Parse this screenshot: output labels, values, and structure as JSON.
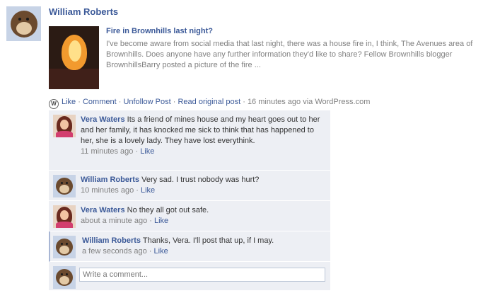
{
  "post": {
    "author": "William Roberts",
    "title": "Fire in Brownhills last night?",
    "excerpt": "I've become aware from social media that last night, there was a house fire in, I think, The Avenues area of Brownhills. Does anyone have any further information they'd like to share? Fellow Brownhills blogger BrownhillsBarry posted a picture of the fire ...",
    "actions": {
      "like": "Like",
      "comment": "Comment",
      "unfollow": "Unfollow Post",
      "read_original": "Read original post",
      "timestamp": "16 minutes ago via WordPress.com",
      "sep": " · "
    }
  },
  "comments": [
    {
      "author": "Vera Waters",
      "text": "Its a friend of mines house and my heart goes out to her and her family, it has knocked me sick to think that has happened to her, she is a lovely lady. They have lost everythink.",
      "time": "11 minutes ago",
      "like": "Like"
    },
    {
      "author": "William Roberts",
      "text": "Very sad. I trust nobody was hurt?",
      "time": "10 minutes ago",
      "like": "Like"
    },
    {
      "author": "Vera Waters",
      "text": "No they all got out safe.",
      "time": "about a minute ago",
      "like": "Like"
    },
    {
      "author": "William Roberts",
      "text": "Thanks, Vera. I'll post that up, if I may.",
      "time": "a few seconds ago",
      "like": "Like"
    }
  ],
  "write_comment": {
    "placeholder": "Write a comment..."
  }
}
